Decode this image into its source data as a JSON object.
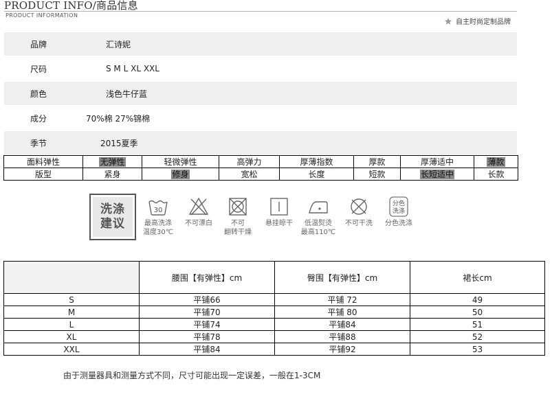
{
  "header": {
    "title": "PRODUCT INFO/商品信息",
    "subtitle": "PRODUCT  INFORMATION",
    "brand_slogan": "自主时尚定制品牌"
  },
  "info_rows": [
    {
      "label": "品牌",
      "value": "汇诗妮"
    },
    {
      "label": "尺码",
      "value": "S  M  L XL XXL"
    },
    {
      "label": "颜色",
      "value": "浅色牛仔蓝"
    },
    {
      "label": "成分",
      "value": "70%棉  27%锦棉"
    },
    {
      "label": "季节",
      "value": "2015夏季"
    }
  ],
  "attributes": {
    "elasticity": {
      "label": "面料弹性",
      "options": [
        {
          "text": "无弹性",
          "selected": true
        },
        {
          "text": "轻微弹性",
          "selected": false
        },
        {
          "text": "高弹力",
          "selected": false
        },
        {
          "text": "厚薄指数",
          "selected": false
        },
        {
          "text": "厚款",
          "selected": false
        },
        {
          "text": "厚薄适中",
          "selected": false
        },
        {
          "text": "薄款",
          "selected": true
        }
      ]
    },
    "fit": {
      "label": "版型",
      "options": [
        {
          "text": "紧身",
          "selected": false
        },
        {
          "text": "修身",
          "selected": true
        },
        {
          "text": "宽松",
          "selected": false
        },
        {
          "text": "长度",
          "selected": false
        },
        {
          "text": "短款",
          "selected": false
        },
        {
          "text": "长短适中",
          "selected": true
        },
        {
          "text": "长款",
          "selected": false
        }
      ]
    }
  },
  "care": {
    "title_line1": "洗涤",
    "title_line2": "建议",
    "items": [
      {
        "icon": "wash-30-icon",
        "label_line1": "最高洗涤",
        "label_line2": "温度30℃",
        "wash_temp": "30"
      },
      {
        "icon": "no-bleach-icon",
        "label_line1": "不可漂白",
        "label_line2": ""
      },
      {
        "icon": "no-tumble-dry-icon",
        "label_line1": "不可",
        "label_line2": "翻转干燥"
      },
      {
        "icon": "hang-dry-icon",
        "label_line1": "悬挂晾干",
        "label_line2": ""
      },
      {
        "icon": "iron-low-icon",
        "label_line1": "低温熨烫",
        "label_line2": "最高110℃"
      },
      {
        "icon": "no-dry-clean-icon",
        "label_line1": "不可干洗",
        "label_line2": ""
      },
      {
        "icon": "wash-separately-icon",
        "label_line1": "分色洗涤",
        "label_line2": "",
        "badge_line1": "分色",
        "badge_line2": "洗涤"
      }
    ]
  },
  "size_table": {
    "headers": [
      "",
      "腰围【有弹性】cm",
      "臀围【有弹性】cm",
      "裙长cm"
    ],
    "rows": [
      [
        "S",
        "平铺66",
        "平铺 72",
        "49"
      ],
      [
        "M",
        "平铺70",
        "平铺 80",
        "50"
      ],
      [
        "L",
        "平铺74",
        "平铺84",
        "51"
      ],
      [
        "XL",
        "平铺78",
        "平铺88",
        "52"
      ],
      [
        "XXL",
        "平铺84",
        "平铺92",
        "53"
      ]
    ]
  },
  "footnote": "由于测量器具和测量方式不同，尺寸可能出现一定误差，一般在1-3CM",
  "colors": {
    "highlight": "#8a8a8a",
    "row_shade": "#efefef",
    "border": "#000000"
  }
}
